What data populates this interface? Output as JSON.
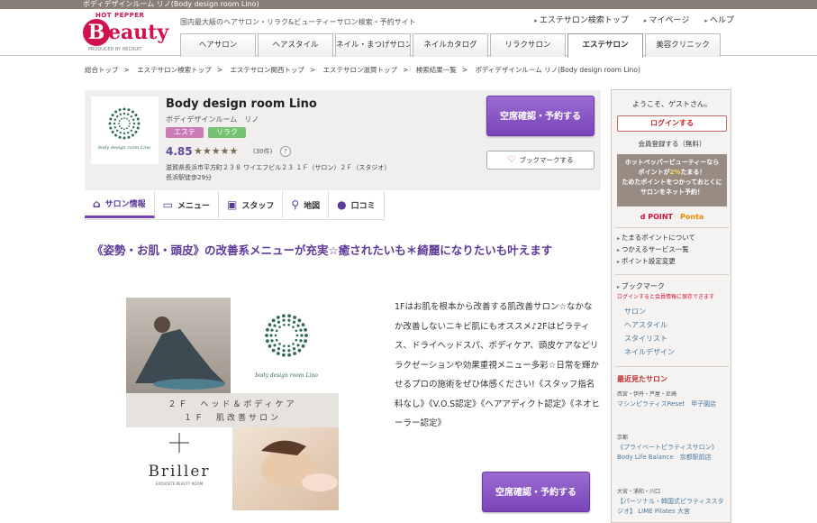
{
  "topbar": {
    "text": "ボディデザインルーム リノ(Body design room Lino)"
  },
  "header": {
    "logo_top": "HOT PEPPER",
    "logo_letter": "B",
    "logo_word": "eauty",
    "logo_by": "PRODUCED BY RECRUIT",
    "tagline": "国内最大級のヘアサロン・リラク&ビューティーサロン検索・予約サイト",
    "links": [
      "エステサロン検索トップ",
      "マイページ",
      "ヘルプ"
    ],
    "tabs": [
      "ヘアサロン",
      "ヘアスタイル",
      "ネイル・まつげサロン",
      "ネイルカタログ",
      "リラクサロン",
      "エステサロン",
      "美容クリニック"
    ],
    "active_tab": "エステサロン"
  },
  "breadcrumb": [
    "総合トップ",
    "エステサロン検索トップ",
    "エステサロン関西トップ",
    "エステサロン滋賀トップ",
    "検索結果一覧",
    "ボディデザインルーム リノ(Body design room Lino)"
  ],
  "salon": {
    "name": "Body design room Lino",
    "kana": "ボディデザインルーム　リノ",
    "tags": [
      "エステ",
      "リラク"
    ],
    "rating": "4.85",
    "stars": "★★★★★",
    "review_count": "(30件)",
    "help": "?",
    "address": "滋賀県長浜市平方町２３８ ワイエフビル２３ １Ｆ（サロン）２Ｆ（スタジオ）",
    "access": "長浜駅徒歩29分",
    "logo_text": "body design room Lino"
  },
  "buttons": {
    "reserve": "空席確認・予約する",
    "bookmark": "ブックマークする"
  },
  "subtabs": [
    {
      "label": "サロン情報",
      "icon": "home-icon"
    },
    {
      "label": "メニュー",
      "icon": "ticket-icon"
    },
    {
      "label": "スタッフ",
      "icon": "staff-icon"
    },
    {
      "label": "地図",
      "icon": "map-pin-icon"
    },
    {
      "label": "口コミ",
      "icon": "chat-icon"
    }
  ],
  "catch": "《姿勢・お肌・頭皮》の改善系メニューが充実☆癒されたいも＊綺麗になりたいも叶えます",
  "photo": {
    "line1": "２Ｆ　ヘッド＆ボディケア",
    "line2": "１Ｆ　肌改善サロン",
    "brand": "Briller",
    "brand_sub": "EXQUISITE BEAUTY ROOM",
    "logo_text": "body design room Lino"
  },
  "description": "1Fはお肌を根本から改善する肌改善サロン☆なかなか改善しないニキビ肌にもオススメ♪2Fはピラティス、ドライヘッドスパ、ボディケア、頭皮ケアなどリラクゼーションや効果重視メニュー多彩☆日常を輝かせるプロの施術をぜひ体感ください!《スタッフ指名料なし》《V.O.S認定》《ヘアアディクト認定》《ネオヒーラー認定》",
  "sidebar": {
    "welcome": "ようこそ、ゲストさん。",
    "login": "ログインする",
    "register": "会員登録する（無料）",
    "point_line1": "ホットペッパービューティーなら",
    "point_line2a": "ポイントが",
    "point_line2b": "2%",
    "point_line2c": "たまる！",
    "point_line3": "ためたポイントをつかっておとくに",
    "point_line4": "サロンをネット予約！",
    "dpoint": "d POINT",
    "ponta": "Ponta",
    "point_links": [
      "たまるポイントについて",
      "つかえるサービス一覧",
      "ポイント設定変更"
    ],
    "bookmark_title": "ブックマーク",
    "bookmark_note": "ログインすると会員情報に保存できます",
    "bookmark_items": [
      "サロン",
      "ヘアスタイル",
      "スタイリスト",
      "ネイルデザイン"
    ],
    "recent_title": "最近見たサロン",
    "recent": [
      {
        "area": "西宮・伊丹・芦屋・尼崎",
        "name": "マシンピラティスReset　甲子園店"
      },
      {
        "area": "京都",
        "name": "《プライベートピラティスサロン》Body Life Balance　京都駅前店"
      },
      {
        "area": "大宮・浦和・川口",
        "name": "【パーソナル・韓国式ピラティススタジオ】 LIME Pilates 大宮"
      }
    ]
  },
  "colors": {
    "accent": "#7a44b8",
    "brand": "#d0114c",
    "catch": "#5d3a99"
  }
}
